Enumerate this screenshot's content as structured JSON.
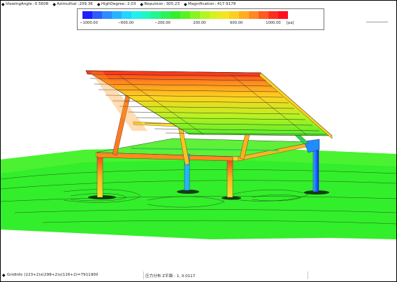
{
  "info_bar": [
    {
      "key": "ViewingAngle",
      "value": "0.5608"
    },
    {
      "key": "Azimuthal",
      "value": "209.36"
    },
    {
      "key": "HighDegree",
      "value": "2.03"
    },
    {
      "key": "Repulsion",
      "value": "305.23"
    },
    {
      "key": "Magnification",
      "value": "417.9178"
    }
  ],
  "legend": {
    "colors": [
      "#1f1fff",
      "#2f5cff",
      "#2f8cff",
      "#27b4ff",
      "#1fd6ff",
      "#1ff0ef",
      "#20f7c0",
      "#26f58e",
      "#2bf25a",
      "#31f02a",
      "#59f21f",
      "#86f520",
      "#b2f521",
      "#d9f020",
      "#f4e51f",
      "#ffcf1f",
      "#ffae1f",
      "#ff8a1f",
      "#ff5a1f",
      "#ff2f1f",
      "#ff0f1f"
    ],
    "ticks": [
      "−1000.00",
      "−600.00",
      "−200.00",
      "200.00",
      "600.00",
      "1000.00"
    ],
    "unit": "[pa]"
  },
  "status": {
    "grid_label": "GridInfo",
    "grid_value": "(223+2)x(298+2)x(116+2)=7911900",
    "plane_info": "圧力分布 Z平面 : 1, 0.0117"
  }
}
